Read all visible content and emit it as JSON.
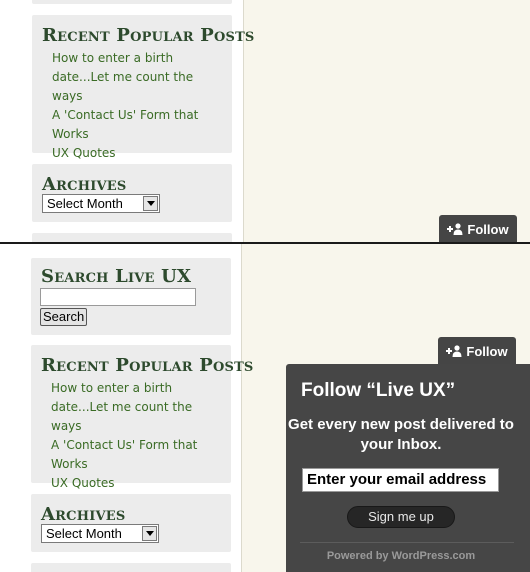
{
  "top_view": {
    "recent_posts": {
      "title": "Recent Popular Posts",
      "items": [
        "How to enter a birth date...Let me count the ways",
        "A 'Contact Us' Form that Works",
        "UX Quotes"
      ]
    },
    "archives": {
      "title": "Archives",
      "select_value": "Select Month"
    },
    "follow_tab": {
      "label": "Follow",
      "icon": "person-add-icon"
    }
  },
  "bottom_view": {
    "search": {
      "title": "Search Live UX",
      "input_value": "",
      "button_label": "Search"
    },
    "recent_posts": {
      "title": "Recent Popular Posts",
      "items": [
        "How to enter a birth date...Let me count the ways",
        "A 'Contact Us' Form that Works",
        "UX Quotes"
      ]
    },
    "archives": {
      "title": "Archives",
      "select_value": "Select Month"
    },
    "follow_tab": {
      "label": "Follow",
      "icon": "person-add-icon"
    },
    "follow_popup": {
      "title": "Follow “Live UX”",
      "description": "Get every new post delivered to your Inbox.",
      "email_value": "Enter your email address",
      "signup_label": "Sign me up",
      "powered_by": "Powered by WordPress.com"
    }
  },
  "colors": {
    "content_background": "#f8f6ec",
    "widget_background": "#ececec",
    "link_green": "#3a6b25",
    "heading_green": "#2d4a2d",
    "follow_dark": "#454545"
  }
}
